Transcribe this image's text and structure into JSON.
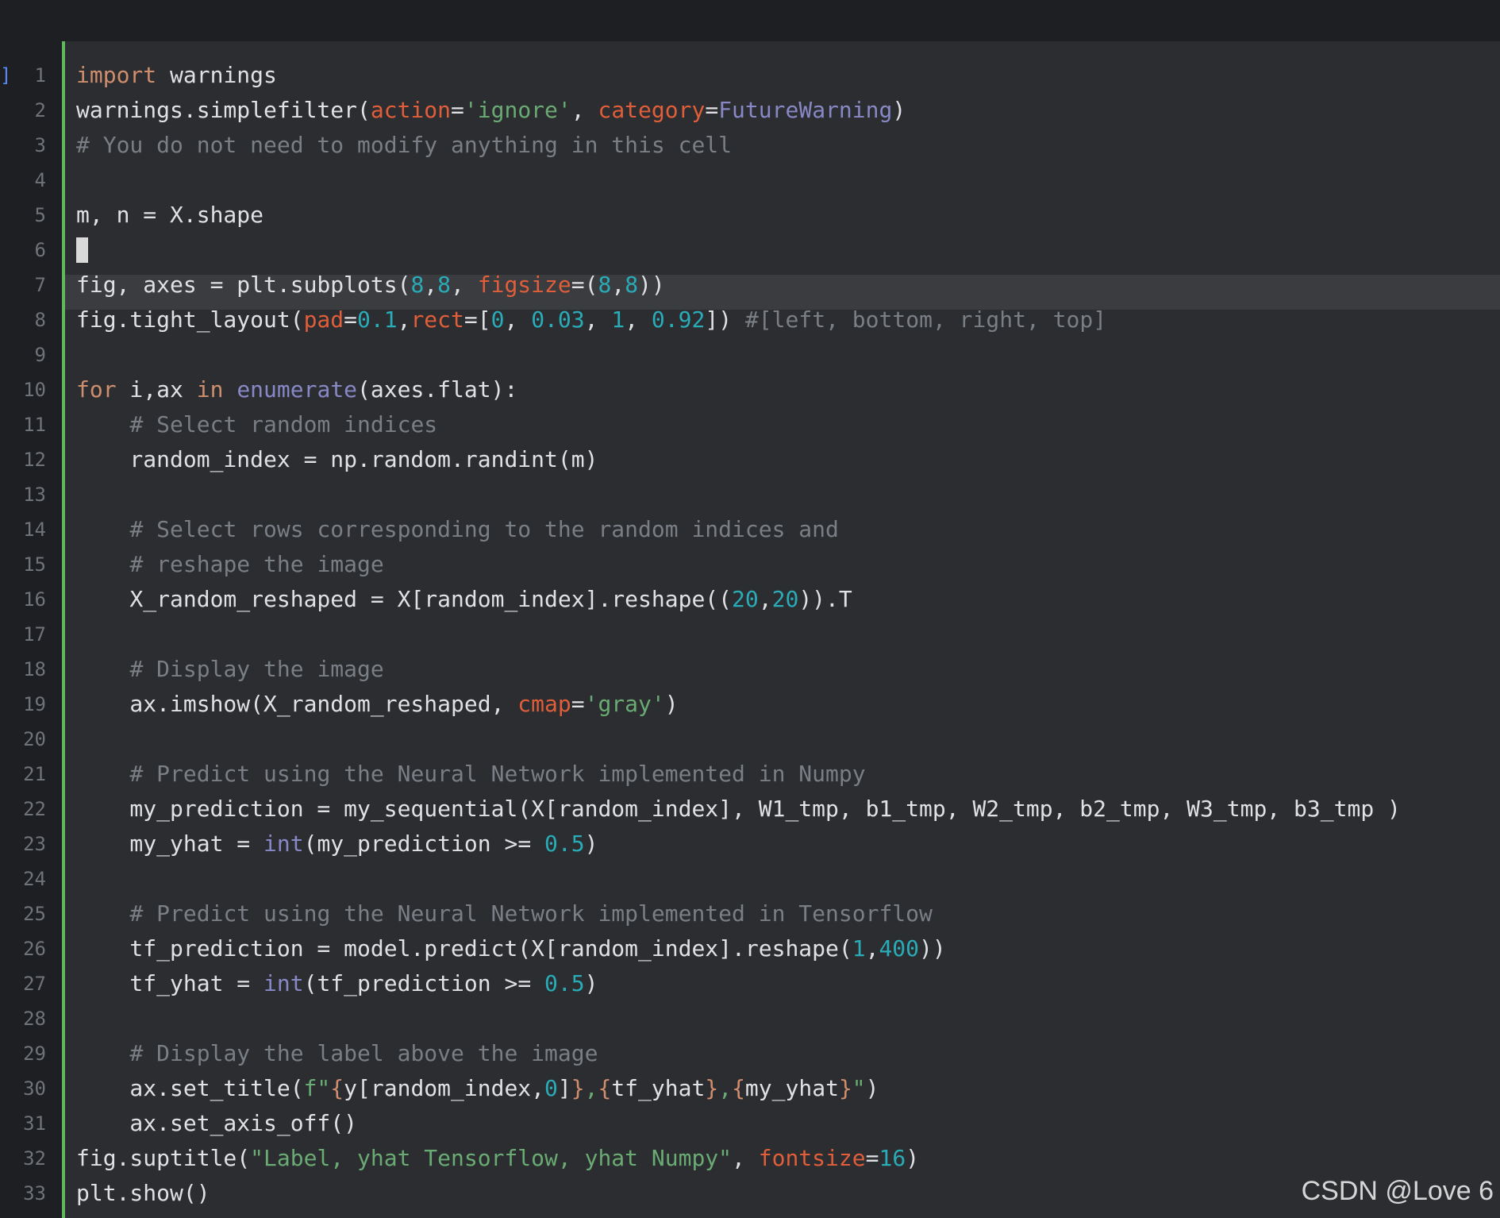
{
  "gutter": {
    "exec_marker": "]"
  },
  "watermark": "CSDN @Love 6",
  "lines": [
    [
      [
        "kw",
        "import"
      ],
      [
        "plain",
        " warnings"
      ]
    ],
    [
      [
        "plain",
        "warnings.simplefilter("
      ],
      [
        "param",
        "action"
      ],
      [
        "plain",
        "="
      ],
      [
        "str",
        "'ignore'"
      ],
      [
        "plain",
        ", "
      ],
      [
        "param",
        "category"
      ],
      [
        "plain",
        "="
      ],
      [
        "builtin",
        "FutureWarning"
      ],
      [
        "plain",
        ")"
      ]
    ],
    [
      [
        "comment",
        "# You do not need to modify anything in this cell"
      ]
    ],
    [],
    [
      [
        "plain",
        "m, n = X.shape"
      ]
    ],
    [],
    [
      [
        "plain",
        "fig, axes = plt.subplots("
      ],
      [
        "num",
        "8"
      ],
      [
        "plain",
        ","
      ],
      [
        "num",
        "8"
      ],
      [
        "plain",
        ", "
      ],
      [
        "param",
        "figsize"
      ],
      [
        "plain",
        "=("
      ],
      [
        "num",
        "8"
      ],
      [
        "plain",
        ","
      ],
      [
        "num",
        "8"
      ],
      [
        "plain",
        "))"
      ]
    ],
    [
      [
        "plain",
        "fig.tight_layout("
      ],
      [
        "param",
        "pad"
      ],
      [
        "plain",
        "="
      ],
      [
        "num",
        "0.1"
      ],
      [
        "plain",
        ","
      ],
      [
        "param",
        "rect"
      ],
      [
        "plain",
        "=["
      ],
      [
        "num",
        "0"
      ],
      [
        "plain",
        ", "
      ],
      [
        "num",
        "0.03"
      ],
      [
        "plain",
        ", "
      ],
      [
        "num",
        "1"
      ],
      [
        "plain",
        ", "
      ],
      [
        "num",
        "0.92"
      ],
      [
        "plain",
        "]) "
      ],
      [
        "comment",
        "#[left, bottom, right, top]"
      ]
    ],
    [],
    [
      [
        "kw",
        "for"
      ],
      [
        "plain",
        " i,ax "
      ],
      [
        "kw",
        "in"
      ],
      [
        "plain",
        " "
      ],
      [
        "builtin",
        "enumerate"
      ],
      [
        "plain",
        "(axes.flat):"
      ]
    ],
    [
      [
        "plain",
        "    "
      ],
      [
        "comment",
        "# Select random indices"
      ]
    ],
    [
      [
        "plain",
        "    random_index = np.random.randint(m)"
      ]
    ],
    [],
    [
      [
        "plain",
        "    "
      ],
      [
        "comment",
        "# Select rows corresponding to the random indices and"
      ]
    ],
    [
      [
        "plain",
        "    "
      ],
      [
        "comment",
        "# reshape the image"
      ]
    ],
    [
      [
        "plain",
        "    X_random_reshaped = X[random_index].reshape(("
      ],
      [
        "num",
        "20"
      ],
      [
        "plain",
        ","
      ],
      [
        "num",
        "20"
      ],
      [
        "plain",
        ")).T"
      ]
    ],
    [],
    [
      [
        "plain",
        "    "
      ],
      [
        "comment",
        "# Display the image"
      ]
    ],
    [
      [
        "plain",
        "    ax.imshow(X_random_reshaped, "
      ],
      [
        "param",
        "cmap"
      ],
      [
        "plain",
        "="
      ],
      [
        "str",
        "'gray'"
      ],
      [
        "plain",
        ")"
      ]
    ],
    [],
    [
      [
        "plain",
        "    "
      ],
      [
        "comment",
        "# Predict using the Neural Network implemented in Numpy"
      ]
    ],
    [
      [
        "plain",
        "    my_prediction = my_sequential(X[random_index], W1_tmp, b1_tmp, W2_tmp, b2_tmp, W3_tmp, b3_tmp )"
      ]
    ],
    [
      [
        "plain",
        "    my_yhat = "
      ],
      [
        "builtin",
        "int"
      ],
      [
        "plain",
        "(my_prediction >= "
      ],
      [
        "num",
        "0.5"
      ],
      [
        "plain",
        ")"
      ]
    ],
    [],
    [
      [
        "plain",
        "    "
      ],
      [
        "comment",
        "# Predict using the Neural Network implemented in Tensorflow"
      ]
    ],
    [
      [
        "plain",
        "    tf_prediction = model.predict(X[random_index].reshape("
      ],
      [
        "num",
        "1"
      ],
      [
        "plain",
        ","
      ],
      [
        "num",
        "400"
      ],
      [
        "plain",
        "))"
      ]
    ],
    [
      [
        "plain",
        "    tf_yhat = "
      ],
      [
        "builtin",
        "int"
      ],
      [
        "plain",
        "(tf_prediction >= "
      ],
      [
        "num",
        "0.5"
      ],
      [
        "plain",
        ")"
      ]
    ],
    [],
    [
      [
        "plain",
        "    "
      ],
      [
        "comment",
        "# Display the label above the image"
      ]
    ],
    [
      [
        "plain",
        "    ax.set_title("
      ],
      [
        "str",
        "f\""
      ],
      [
        "fbrace",
        "{"
      ],
      [
        "plain",
        "y[random_index,"
      ],
      [
        "num",
        "0"
      ],
      [
        "plain",
        "]"
      ],
      [
        "fbrace",
        "}"
      ],
      [
        "str",
        ","
      ],
      [
        "fbrace",
        "{"
      ],
      [
        "plain",
        "tf_yhat"
      ],
      [
        "fbrace",
        "}"
      ],
      [
        "str",
        ","
      ],
      [
        "fbrace",
        "{"
      ],
      [
        "plain",
        "my_yhat"
      ],
      [
        "fbrace",
        "}"
      ],
      [
        "str",
        "\""
      ],
      [
        "plain",
        ")"
      ]
    ],
    [
      [
        "plain",
        "    ax.set_axis_off()"
      ]
    ],
    [
      [
        "plain",
        "fig.suptitle("
      ],
      [
        "str",
        "\"Label, yhat Tensorflow, yhat Numpy\""
      ],
      [
        "plain",
        ", "
      ],
      [
        "param",
        "fontsize"
      ],
      [
        "plain",
        "="
      ],
      [
        "num",
        "16"
      ],
      [
        "plain",
        ")"
      ]
    ],
    [
      [
        "plain",
        "plt.show()"
      ]
    ]
  ],
  "current_line": 6,
  "colors": {
    "keyword": "#cf8e6d",
    "string": "#6aab73",
    "number": "#2aacb8",
    "param": "#e05e3a",
    "builtin": "#8888c6",
    "comment": "#7a7e85",
    "text": "#dfe1e5",
    "change_bar": "#5fb85b"
  }
}
